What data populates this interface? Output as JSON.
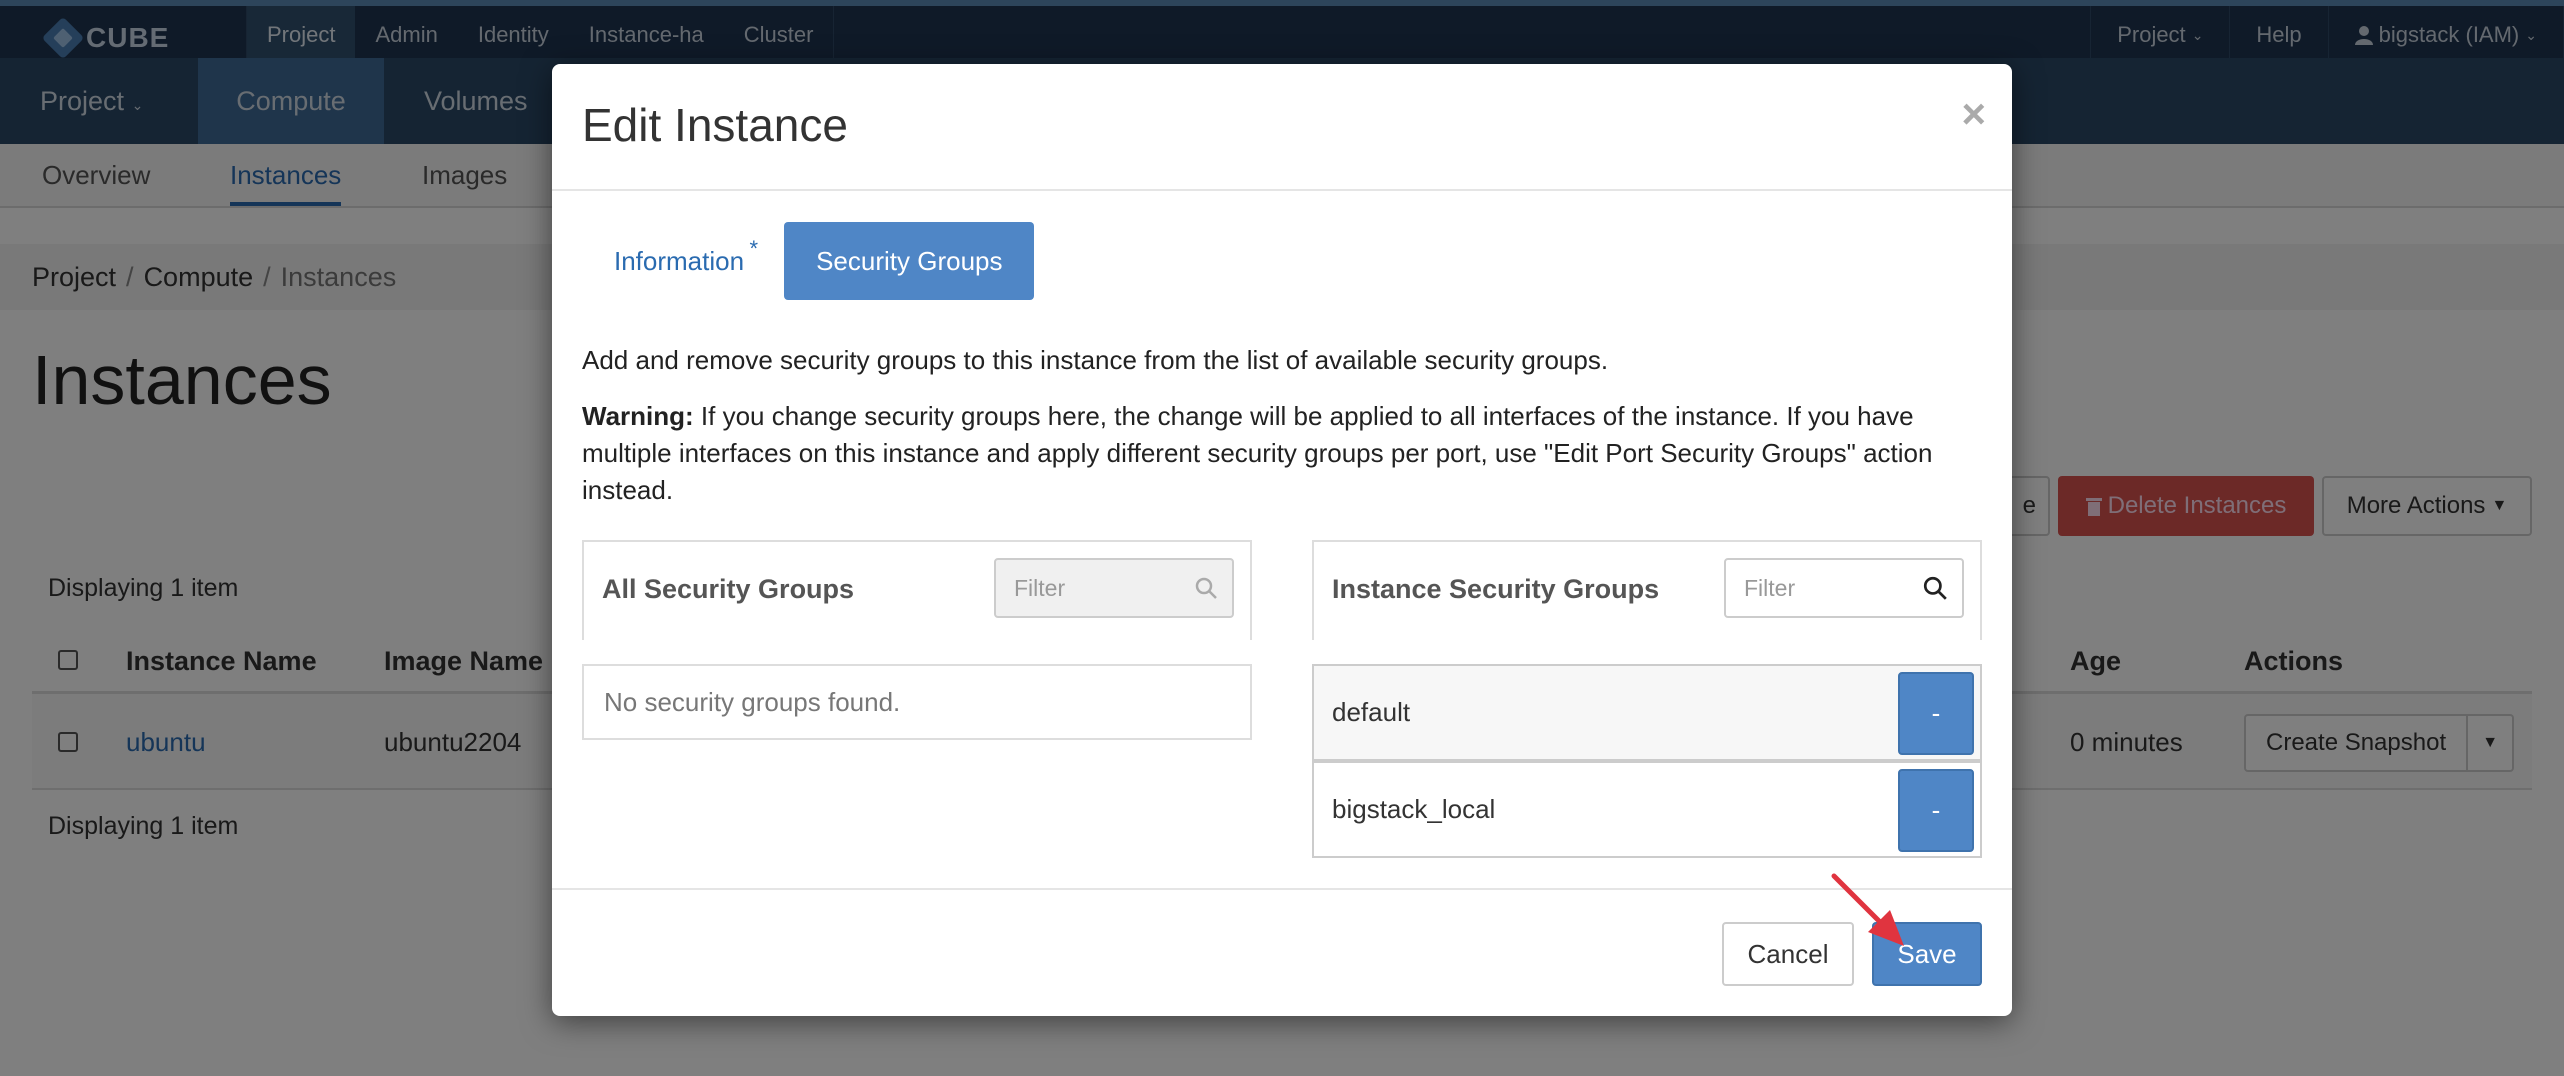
{
  "topbar": {
    "logo_text": "CUBE",
    "nav": [
      "Project",
      "Admin",
      "Identity",
      "Instance-ha",
      "Cluster"
    ],
    "right": {
      "project": "Project",
      "help": "Help",
      "user": "bigstack (IAM)"
    }
  },
  "second_nav": {
    "project": "Project",
    "compute": "Compute",
    "volumes": "Volumes"
  },
  "third_nav": {
    "overview": "Overview",
    "instances": "Instances",
    "images": "Images"
  },
  "breadcrumb": {
    "project": "Project",
    "compute": "Compute",
    "instances": "Instances",
    "sep": "/"
  },
  "page": {
    "title": "Instances",
    "display_count": "Displaying 1 item",
    "partial_button": "e",
    "delete_button": "Delete Instances",
    "more_button": "More Actions"
  },
  "table": {
    "headers": {
      "name": "Instance Name",
      "image": "Image Name",
      "age": "Age",
      "actions": "Actions"
    },
    "row": {
      "name": "ubuntu",
      "image": "ubuntu2204",
      "age": "0 minutes",
      "action": "Create Snapshot"
    }
  },
  "modal": {
    "title": "Edit Instance",
    "close": "×",
    "tabs": {
      "information": "Information",
      "required_mark": "*",
      "security_groups": "Security Groups"
    },
    "help_text": "Add and remove security groups to this instance from the list of available security groups.",
    "warning_label": "Warning:",
    "warning_text": " If you change security groups here, the change will be applied to all interfaces of the instance. If you have multiple interfaces on this instance and apply different security groups per port, use \"Edit Port Security Groups\" action instead.",
    "all_groups": {
      "title": "All Security Groups",
      "filter_placeholder": "Filter",
      "empty": "No security groups found."
    },
    "instance_groups": {
      "title": "Instance Security Groups",
      "filter_placeholder": "Filter",
      "items": [
        {
          "name": "default",
          "action": "-"
        },
        {
          "name": "bigstack_local",
          "action": "-"
        }
      ]
    },
    "footer": {
      "cancel": "Cancel",
      "save": "Save"
    }
  },
  "colors": {
    "primary": "#4f86c6",
    "danger": "#d9534f",
    "topbar": "#1f3550",
    "annotation_arrow": "#e0343f"
  }
}
